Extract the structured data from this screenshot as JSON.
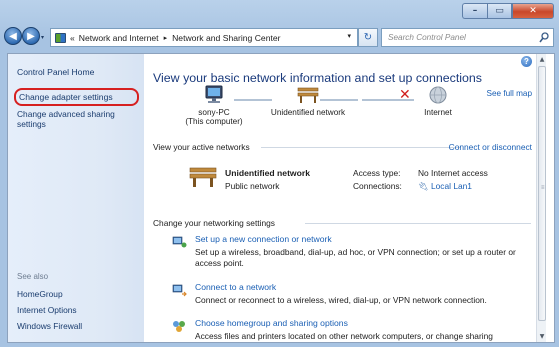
{
  "window": {
    "controls": {
      "minimize": "–",
      "maximize": "▭",
      "close": "✕"
    }
  },
  "navbar": {
    "back_icon": "arrow-left-icon",
    "forward_icon": "arrow-right-icon",
    "recent_dropdown": "▾",
    "breadcrumb_prefix": "«",
    "breadcrumbs": [
      "Network and Internet",
      "Network and Sharing Center"
    ],
    "breadcrumb_separator": "▸",
    "address_dropdown": "▾",
    "refresh_glyph": "↻",
    "search_placeholder": "Search Control Panel"
  },
  "left_pane": {
    "home": "Control Panel Home",
    "links": [
      "Change adapter settings",
      "Change advanced sharing settings"
    ],
    "highlight_color": "#d62020",
    "see_also_title": "See also",
    "see_also": [
      "HomeGroup",
      "Internet Options",
      "Windows Firewall"
    ]
  },
  "main": {
    "heading": "View your basic network information and set up connections",
    "see_full_map": "See full map",
    "map": {
      "computer": {
        "name": "sony-PC",
        "sub": "(This computer)",
        "icon": "computer-icon"
      },
      "network": {
        "name": "Unidentified network",
        "icon": "bench-icon"
      },
      "internet": {
        "name": "Internet",
        "icon": "globe-icon"
      },
      "broken_link": "✕"
    },
    "active_networks_title": "View your active networks",
    "connect_or_disconnect": "Connect or disconnect",
    "active_network": {
      "name": "Unidentified network",
      "type": "Public network",
      "access_type_label": "Access type:",
      "access_type_value": "No Internet access",
      "connections_label": "Connections:",
      "connections_value": "Local Lan1"
    },
    "settings_title": "Change your networking settings",
    "tasks": [
      {
        "title": "Set up a new connection or network",
        "desc": "Set up a wireless, broadband, dial-up, ad hoc, or VPN connection; or set up a router or access point.",
        "icon": "new-connection-icon"
      },
      {
        "title": "Connect to a network",
        "desc": "Connect or reconnect to a wireless, wired, dial-up, or VPN network connection.",
        "icon": "connect-network-icon"
      },
      {
        "title": "Choose homegroup and sharing options",
        "desc": "Access files and printers located on other network computers, or change sharing",
        "icon": "homegroup-icon"
      }
    ]
  },
  "scrollbar": {
    "up": "▲",
    "down": "▼",
    "grip": "≡"
  },
  "colors": {
    "link": "#1a5fb4",
    "heading": "#1a3a7c",
    "accent_red": "#d62020"
  }
}
